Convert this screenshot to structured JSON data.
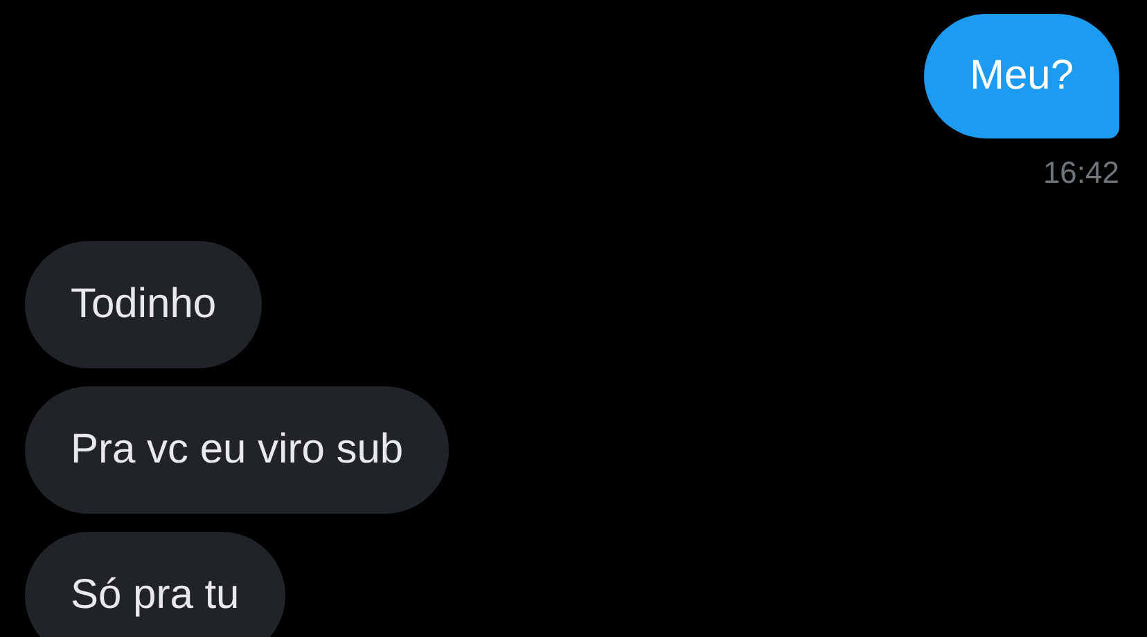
{
  "messages": [
    {
      "kind": "sent",
      "text": "Meu?",
      "time": "16:42"
    },
    {
      "kind": "received",
      "text": "Todinho"
    },
    {
      "kind": "received",
      "text": "Pra vc eu viro sub"
    },
    {
      "kind": "received",
      "text": "Só pra tu"
    }
  ]
}
